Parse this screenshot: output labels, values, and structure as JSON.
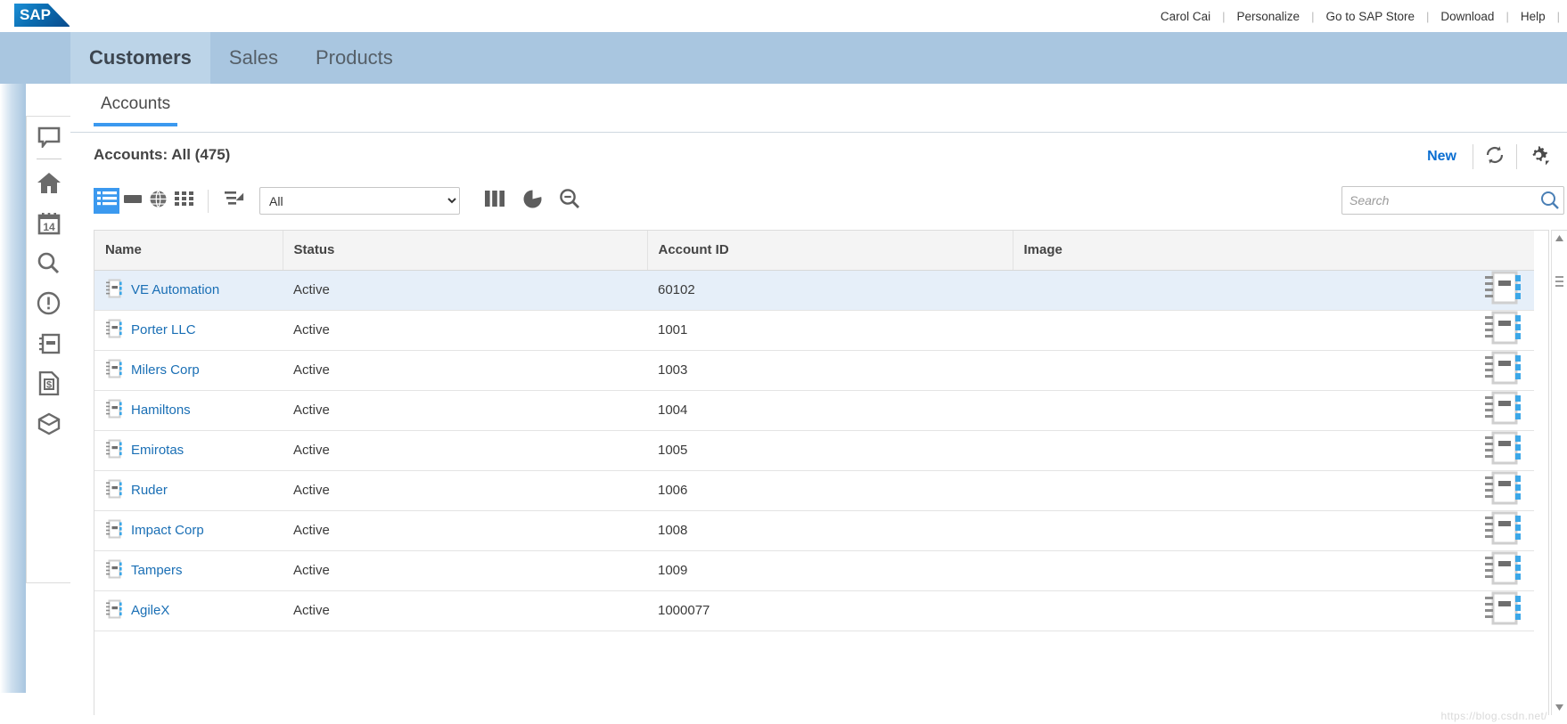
{
  "brand": {
    "logo_text": "SAP",
    "accent": "#0a6ed1",
    "module_bar_bg": "#a9c6e0"
  },
  "topbar": {
    "links": [
      {
        "label": "Carol Cai",
        "name": "user-name-link"
      },
      {
        "label": "Personalize",
        "name": "personalize-link"
      },
      {
        "label": "Go to SAP Store",
        "name": "sap-store-link"
      },
      {
        "label": "Download",
        "name": "download-link"
      },
      {
        "label": "Help",
        "name": "help-link"
      }
    ],
    "separator": "|"
  },
  "modules": [
    {
      "label": "Customers",
      "active": true
    },
    {
      "label": "Sales",
      "active": false
    },
    {
      "label": "Products",
      "active": false
    }
  ],
  "sidebar": {
    "items": [
      {
        "icon": "feed-icon",
        "label": "Feed"
      },
      {
        "icon": "home-icon",
        "label": "Home"
      },
      {
        "icon": "calendar-icon",
        "label": "Calendar",
        "day": "14"
      },
      {
        "icon": "search-icon",
        "label": "Search"
      },
      {
        "icon": "alert-icon",
        "label": "Alerts"
      },
      {
        "icon": "contacts-icon",
        "label": "Contacts"
      },
      {
        "icon": "invoice-icon",
        "label": "Invoices"
      },
      {
        "icon": "box-icon",
        "label": "Products"
      }
    ]
  },
  "tabs": [
    {
      "label": "Accounts",
      "active": true
    }
  ],
  "list_header": {
    "title": "Accounts: All (475)",
    "new_label": "New",
    "refresh_icon": "refresh-icon",
    "settings_icon": "gear-icon"
  },
  "toolbar": {
    "view_buttons": [
      {
        "icon": "list-view-icon",
        "selected": true
      },
      {
        "icon": "card-view-icon",
        "selected": false
      },
      {
        "icon": "globe-view-icon",
        "selected": false
      },
      {
        "icon": "tile-view-icon",
        "selected": false
      }
    ],
    "sort_icon": "sort-icon",
    "filter_value": "All",
    "filter_options": [
      "All"
    ],
    "tool_icons": [
      {
        "icon": "columns-icon"
      },
      {
        "icon": "chart-pie-icon"
      },
      {
        "icon": "zoom-out-icon"
      }
    ],
    "search": {
      "placeholder": "Search",
      "value": "",
      "icon": "search-icon"
    }
  },
  "table": {
    "columns": [
      "Name",
      "Status",
      "Account ID",
      "Image"
    ],
    "rows": [
      {
        "icon": "account-notebook-icon",
        "name": "VE Automation",
        "status": "Active",
        "account_id": "60102",
        "image": "notebook-thumb",
        "selected": true
      },
      {
        "icon": "account-notebook-icon",
        "name": "Porter LLC",
        "status": "Active",
        "account_id": "1001",
        "image": "notebook-thumb",
        "selected": false
      },
      {
        "icon": "account-notebook-icon",
        "name": "Milers Corp",
        "status": "Active",
        "account_id": "1003",
        "image": "notebook-thumb",
        "selected": false
      },
      {
        "icon": "account-notebook-icon",
        "name": "Hamiltons",
        "status": "Active",
        "account_id": "1004",
        "image": "notebook-thumb",
        "selected": false
      },
      {
        "icon": "account-notebook-icon",
        "name": "Emirotas",
        "status": "Active",
        "account_id": "1005",
        "image": "notebook-thumb",
        "selected": false
      },
      {
        "icon": "account-notebook-icon",
        "name": "Ruder",
        "status": "Active",
        "account_id": "1006",
        "image": "notebook-thumb",
        "selected": false
      },
      {
        "icon": "account-notebook-icon",
        "name": "Impact Corp",
        "status": "Active",
        "account_id": "1008",
        "image": "notebook-thumb",
        "selected": false
      },
      {
        "icon": "account-notebook-icon",
        "name": "Tampers",
        "status": "Active",
        "account_id": "1009",
        "image": "notebook-thumb",
        "selected": false
      },
      {
        "icon": "account-notebook-icon",
        "name": "AgileX",
        "status": "Active",
        "account_id": "1000077",
        "image": "notebook-thumb",
        "selected": false
      }
    ]
  },
  "watermark": "https://blog.csdn.net/"
}
